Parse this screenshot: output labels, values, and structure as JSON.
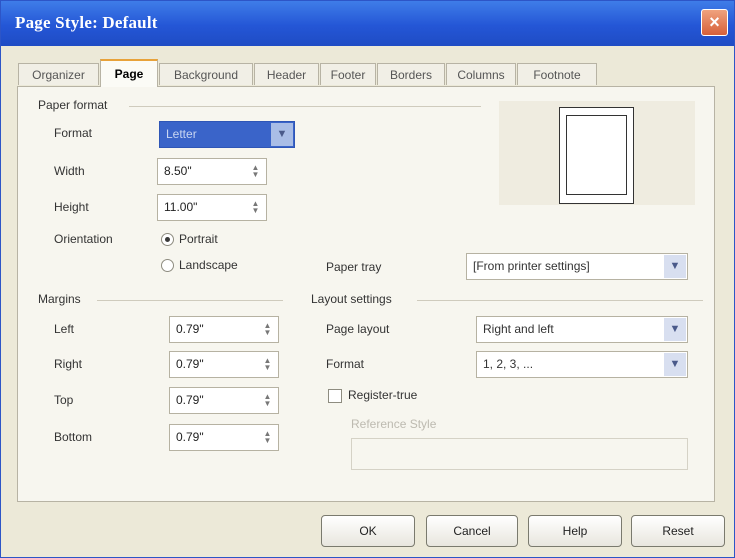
{
  "window": {
    "title": "Page Style: Default",
    "close_glyph": "×"
  },
  "tabs": [
    {
      "label": "Organizer"
    },
    {
      "label": "Page"
    },
    {
      "label": "Background"
    },
    {
      "label": "Header"
    },
    {
      "label": "Footer"
    },
    {
      "label": "Borders"
    },
    {
      "label": "Columns"
    },
    {
      "label": "Footnote"
    }
  ],
  "paper_format": {
    "section_label": "Paper format",
    "format_label": "Format",
    "format_value": "Letter",
    "width_label": "Width",
    "width_value": "8.50\"",
    "height_label": "Height",
    "height_value": "11.00\"",
    "orientation_label": "Orientation",
    "portrait_label": "Portrait",
    "landscape_label": "Landscape",
    "paper_tray_label": "Paper tray",
    "paper_tray_value": "[From printer settings]"
  },
  "margins": {
    "section_label": "Margins",
    "left_label": "Left",
    "left_value": "0.79\"",
    "right_label": "Right",
    "right_value": "0.79\"",
    "top_label": "Top",
    "top_value": "0.79\"",
    "bottom_label": "Bottom",
    "bottom_value": "0.79\""
  },
  "layout": {
    "section_label": "Layout settings",
    "page_layout_label": "Page layout",
    "page_layout_value": "Right and left",
    "format_label": "Format",
    "format_value": "1, 2, 3, ...",
    "register_true_label": "Register-true",
    "reference_style_label": "Reference Style"
  },
  "buttons": {
    "ok": "OK",
    "cancel": "Cancel",
    "help": "Help",
    "reset": "Reset"
  },
  "colors": {
    "titlebar": "#2456d6",
    "active_tab_accent": "#e8a23a",
    "selected_dropdown": "#3a64c9"
  }
}
